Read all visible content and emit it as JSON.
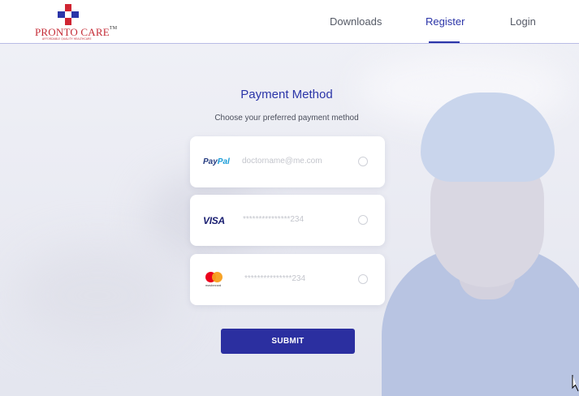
{
  "brand": {
    "name": "PRONTO CARE",
    "trademark": "TM",
    "tagline": "AFFORDABLE QUALITY HEALTHCARE"
  },
  "nav": {
    "items": [
      {
        "label": "Downloads",
        "active": false
      },
      {
        "label": "Register",
        "active": true
      },
      {
        "label": "Login",
        "active": false
      }
    ]
  },
  "page": {
    "title": "Payment Method",
    "subtitle": "Choose your preferred payment method"
  },
  "payment_options": [
    {
      "brand": "PayPal",
      "icon": "paypal-logo-icon",
      "detail": "doctorname@me.com",
      "selected": false
    },
    {
      "brand": "VISA",
      "icon": "visa-logo-icon",
      "detail": "***************234",
      "selected": false
    },
    {
      "brand": "mastercard",
      "icon": "mastercard-logo-icon",
      "detail": "***************234",
      "selected": false
    }
  ],
  "submit_label": "SUBMIT",
  "colors": {
    "accent": "#2b35a8",
    "button": "#2b2fa0",
    "logo_red": "#d02532"
  }
}
